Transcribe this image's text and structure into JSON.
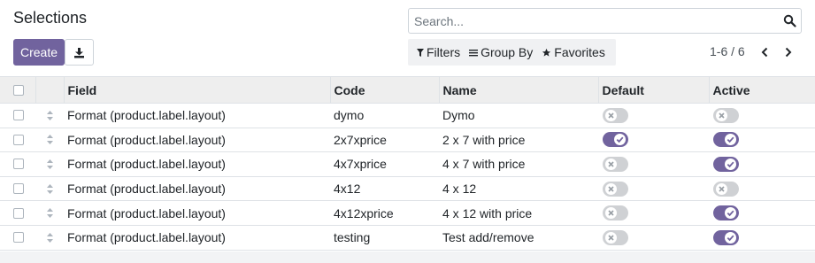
{
  "header": {
    "title": "Selections",
    "create_label": "Create",
    "download_icon": "download-icon"
  },
  "search": {
    "placeholder": "Search...",
    "value": "",
    "icon": "search-icon"
  },
  "filters": {
    "filters_label": "Filters",
    "group_by_label": "Group By",
    "favorites_label": "Favorites"
  },
  "pager": {
    "value": "1-6 / 6"
  },
  "table": {
    "columns": [
      "Field",
      "Code",
      "Name",
      "Default",
      "Active"
    ],
    "rows": [
      {
        "field": "Format (product.label.layout)",
        "code": "dymo",
        "name": "Dymo",
        "default": false,
        "active": false
      },
      {
        "field": "Format (product.label.layout)",
        "code": "2x7xprice",
        "name": "2 x 7 with price",
        "default": true,
        "active": true
      },
      {
        "field": "Format (product.label.layout)",
        "code": "4x7xprice",
        "name": "4 x 7 with price",
        "default": false,
        "active": true
      },
      {
        "field": "Format (product.label.layout)",
        "code": "4x12",
        "name": "4 x 12",
        "default": false,
        "active": false
      },
      {
        "field": "Format (product.label.layout)",
        "code": "4x12xprice",
        "name": "4 x 12 with price",
        "default": false,
        "active": true
      },
      {
        "field": "Format (product.label.layout)",
        "code": "testing",
        "name": "Test add/remove",
        "default": false,
        "active": true
      }
    ]
  },
  "colors": {
    "brand": "#71639e",
    "toggle_off": "#cfd1d4",
    "header_bg": "#eeeeee"
  }
}
